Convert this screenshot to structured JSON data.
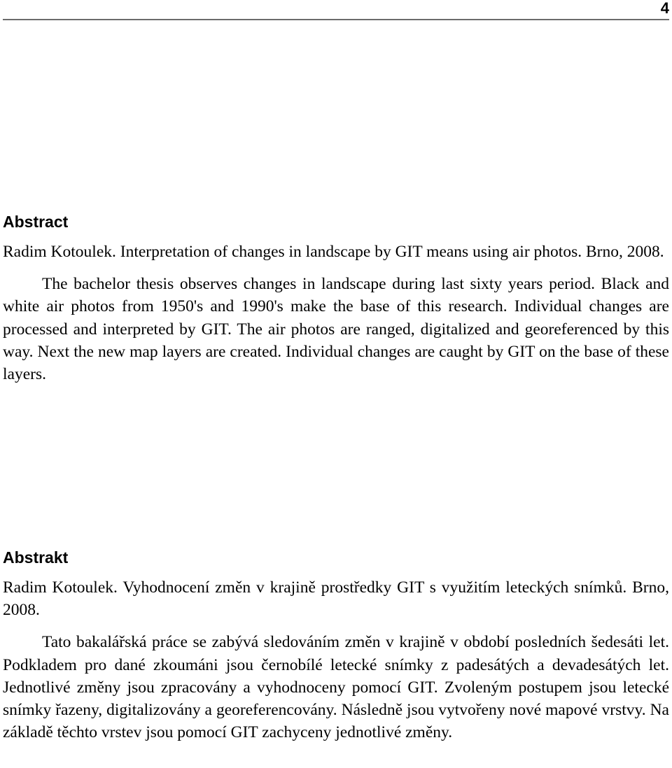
{
  "header": {
    "page_number": "4",
    "rule_color": "#6b6b6b"
  },
  "document": {
    "text_color": "#000000",
    "background_color": "#ffffff"
  },
  "abstract": {
    "heading": "Abstract",
    "citation": "Radim Kotoulek. Interpretation of changes in landscape by GIT means using air photos. Brno, 2008.",
    "body": "The bachelor thesis observes changes in landscape during last sixty years period. Black and white air photos from 1950's and 1990's make the base of this research. Individual changes are processed and interpreted by GIT. The air photos are ranged, digitalized and georeferenced by this way. Next the new map layers are created. Individual changes are caught by GIT on the base of these layers."
  },
  "abstrakt": {
    "heading": "Abstrakt",
    "citation": "Radim Kotoulek. Vyhodnocení změn v krajině prostředky GIT s využitím leteckých snímků. Brno, 2008.",
    "body": "Tato bakalářská práce se zabývá sledováním změn v krajině v období posledních šedesáti let. Podkladem pro dané zkoumáni jsou černobílé letecké snímky z padesátých a devadesátých let. Jednotlivé změny jsou zpracovány a vyhodnoceny pomocí GIT. Zvoleným postupem jsou letecké snímky řazeny, digitalizovány a georeferencovány. Následně jsou vytvořeny nové mapové vrstvy. Na základě těchto vrstev jsou pomocí GIT zachyceny jednotlivé změny."
  }
}
